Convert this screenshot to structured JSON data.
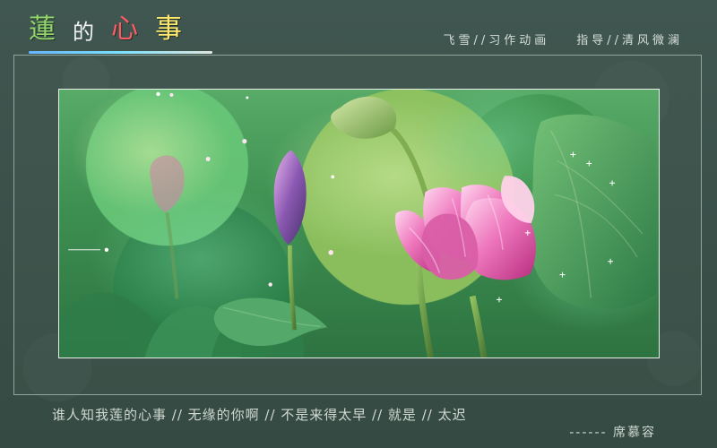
{
  "header": {
    "logo_text_1": "蓮",
    "logo_text_2": "的",
    "logo_text_3": "心",
    "logo_text_4": "事",
    "credit_left": "飞雪//习作动画",
    "credit_right": "指导//清风微澜"
  },
  "footer": {
    "verse": "谁人知我莲的心事  //  无缘的你啊  //  不是来得太早  //  就是  //  太迟",
    "signature": "------ 席慕容"
  },
  "colors": {
    "page_background": "#3a4f46",
    "frame_border": "#90a69a",
    "logo_green": "#93d56c",
    "logo_red": "#ff5b66",
    "logo_yellow": "#ffe66d",
    "text_light": "#d0d8d2"
  }
}
